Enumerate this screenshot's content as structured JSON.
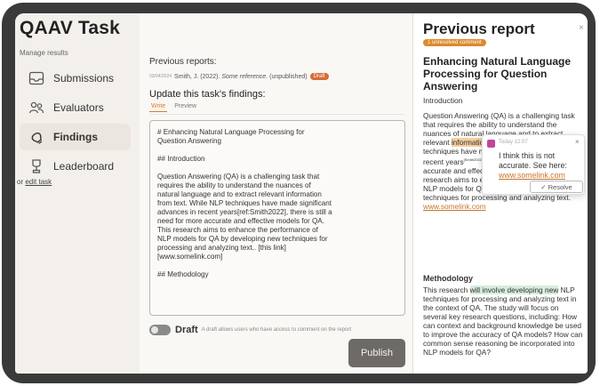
{
  "sidebar": {
    "app_title": "QAAV Task",
    "manage_label": "Manage results",
    "items": [
      {
        "label": "Submissions",
        "icon": "inbox-icon"
      },
      {
        "label": "Evaluators",
        "icon": "users-icon"
      },
      {
        "label": "Findings",
        "icon": "lightbulb-icon"
      },
      {
        "label": "Leaderboard",
        "icon": "trophy-icon"
      }
    ],
    "active_item": "Findings",
    "edit_prefix": "or",
    "edit_link": "edit task"
  },
  "main": {
    "previous_reports_label": "Previous reports:",
    "previous_report": {
      "date": "03/04/2024",
      "author": "Smith, J. (2022).",
      "reference": "Some reference.",
      "status": "(unpublished)",
      "badge": "Draft"
    },
    "update_label": "Update this task's findings:",
    "tabs": {
      "write": "Write",
      "preview": "Preview"
    },
    "editor_text": "# Enhancing Natural Language Processing for\nQuestion Answering\n\n## Introduction\n\nQuestion Answering (QA) is a challenging task that\nrequires the ability to understand the nuances of\nnatural language and to extract relevant information\nfrom text. While NLP techniques have made significant\nadvances in recent years[ref:Smith2022], there is still a\nneed for more accurate and effective models for QA.\nThis research aims to enhance the performance of\nNLP models for QA by developing new techniques for\nprocessing and analyzing text.. [this link]\n[www.somelink.com]\n\n## Methodology",
    "draft_label": "Draft",
    "draft_description": "A draft allows users who have access to comment on the report",
    "publish_label": "Publish"
  },
  "right_panel": {
    "title": "Previous report",
    "close_glyph": "×",
    "unresolved_badge": "1 unresolved comment",
    "heading": "Enhancing Natural Language Processing for Question Answering",
    "intro_label": "Introduction",
    "para1_a": "Question Answering (QA) is a challenging task that requires the ability to understand the nuances of natural language and to extract relevant ",
    "para1_highlight": "information from text.",
    "para1_b": " While NLP techniques have made significant advances in recent years",
    "para1_sup": "[Smith2022]",
    "para1_c": ", there is still a need for more accurate and effective models for QA. This research aims to enhance the performance of NLP models for QA by developing new techniques for processing and analyzing text. ",
    "para1_link": "www.somelink.com",
    "methodology_label": "Methodology",
    "para2_a": "This research ",
    "para2_highlight": "will involve developing new",
    "para2_b": " NLP techniques for processing and analyzing text in the context of QA. The study will focus on several key research questions, including: How can context and background knowledge be used to improve the accuracy of QA models? How can common sense reasoning be incorporated into NLP models for QA?"
  },
  "comment": {
    "time": "Today 12:07",
    "close_glyph": "×",
    "text": "I think this is not accurate. See here: ",
    "link": "www.somelink.com",
    "resolve_label": "✓ Resolve"
  },
  "colors": {
    "accent": "#d86a36",
    "highlight": "#f4cf9c",
    "highlight_green": "#d6eddc",
    "publish": "#6e6a66"
  }
}
